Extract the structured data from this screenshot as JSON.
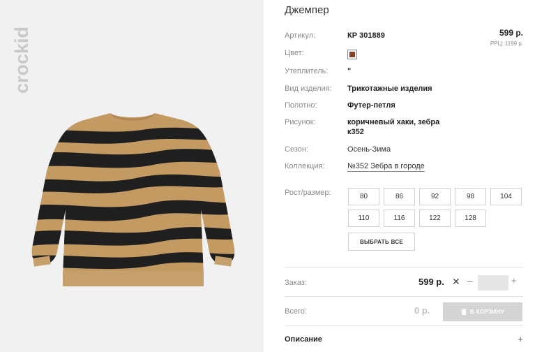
{
  "brand": {
    "name": "crockid"
  },
  "product": {
    "title": "Джемпер",
    "price": "599 р.",
    "rrp": "РРЦ: 1199 р.",
    "color_hex": "#8a3f2e"
  },
  "attributes": [
    {
      "label": "Артикул:",
      "value": "КР 301889"
    },
    {
      "label": "Цвет:",
      "value": ""
    },
    {
      "label": "Утеплитель:",
      "value": "\""
    },
    {
      "label": "Вид изделия:",
      "value": "Трикотажные изделия"
    },
    {
      "label": "Полотно:",
      "value": "Футер-петля"
    },
    {
      "label": "Рисунок:",
      "value": "коричневый хаки, зебра к352"
    },
    {
      "label": "Сезон:",
      "value": "Осень-Зима"
    },
    {
      "label": "Коллекция:",
      "value": "№352 Зебра в городе"
    }
  ],
  "sizes": {
    "label": "Рост/размер:",
    "options": [
      "80",
      "86",
      "92",
      "98",
      "104",
      "110",
      "116",
      "122",
      "128"
    ],
    "select_all": "ВЫБРАТЬ ВСЕ"
  },
  "order": {
    "label": "Заказ:",
    "price": "599 р.",
    "times": "✕",
    "minus": "–",
    "plus": "+",
    "quantity": ""
  },
  "total": {
    "label": "Всего:",
    "value": "0 р.",
    "cart_button": "В КОРЗИНУ"
  },
  "description": {
    "title": "Описание",
    "toggle": "+"
  }
}
